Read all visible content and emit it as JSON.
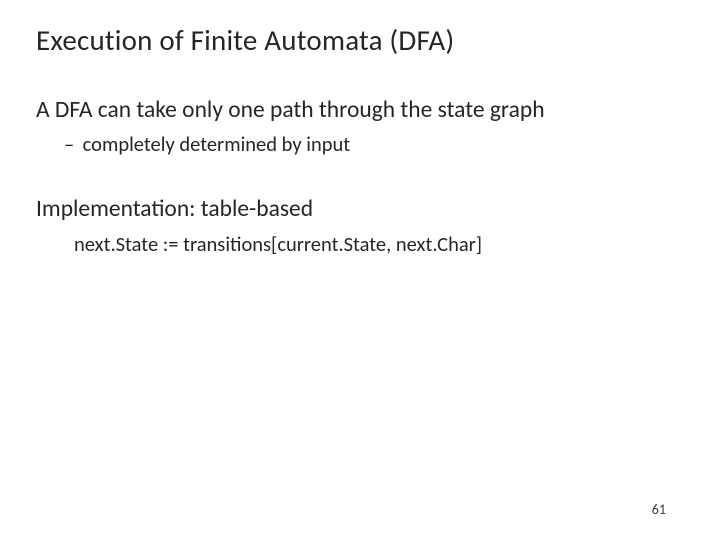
{
  "title": "Execution of Finite Automata (DFA)",
  "line1": "A DFA can take only one path through the state graph",
  "bullet1": "completely determined by input",
  "line2": "Implementation: table-based",
  "code1": "next.State := transitions[current.State, next.Char]",
  "page_number": "61"
}
